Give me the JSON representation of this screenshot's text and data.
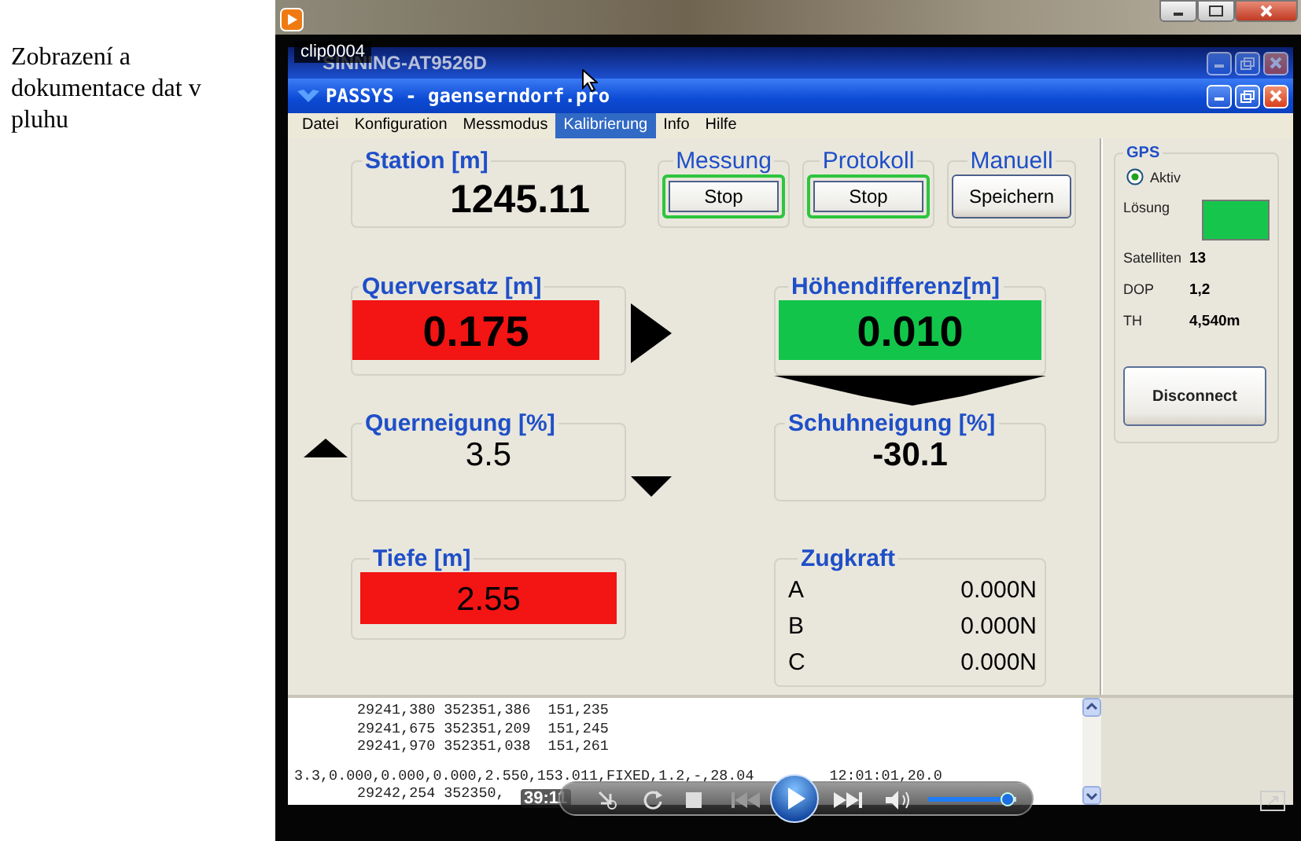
{
  "caption": "Zobrazení a dokumentace dat v pluhu",
  "player": {
    "clip_title": "clip0004",
    "time": "39:11",
    "volume": {
      "level": 0.9
    }
  },
  "outer_window": {
    "title": "SINNING-AT9526D"
  },
  "app_window": {
    "title": "PASSYS - gaenserndorf.pro"
  },
  "menu": [
    {
      "label": "Datei",
      "selected": false
    },
    {
      "label": "Konfiguration",
      "selected": false
    },
    {
      "label": "Messmodus",
      "selected": false
    },
    {
      "label": "Kalibrierung",
      "selected": true
    },
    {
      "label": "Info",
      "selected": false
    },
    {
      "label": "Hilfe",
      "selected": false
    }
  ],
  "station": {
    "label": "Station [m]",
    "value": "1245.11"
  },
  "controls": [
    {
      "label": "Messung",
      "button": "Stop",
      "active": true
    },
    {
      "label": "Protokoll",
      "button": "Stop",
      "active": true
    },
    {
      "label": "Manuell",
      "button": "Speichern",
      "active": false
    }
  ],
  "gauges": [
    {
      "label": "Querversatz [m]",
      "value": "0.175",
      "color": "#f31414"
    },
    {
      "label": "Höhendifferenz[m]",
      "value": "0.010",
      "color": "#12c54a"
    },
    {
      "label": "Querneigung [%]",
      "value": "3.5"
    },
    {
      "label": "Schuhneigung [%]",
      "value": "-30.1"
    },
    {
      "label": "Tiefe [m]",
      "value": "2.55",
      "color": "#f31414"
    }
  ],
  "zugkraft": {
    "label": "Zugkraft",
    "rows": [
      {
        "name": "A",
        "value": "0.000N"
      },
      {
        "name": "B",
        "value": "0.000N"
      },
      {
        "name": "C",
        "value": "0.000N"
      }
    ]
  },
  "gps": {
    "title": "GPS",
    "active": {
      "label": "Aktiv",
      "checked": true
    },
    "solution": {
      "label": "Lösung",
      "color": "#16c64c"
    },
    "fields": [
      {
        "label": "Satelliten",
        "value": "13"
      },
      {
        "label": "DOP",
        "value": "1,2"
      },
      {
        "label": "TH",
        "value": "4,540m"
      }
    ],
    "button": "Disconnect"
  },
  "log": {
    "lines": [
      {
        "kind": "record",
        "parts": [
          "29241,380 352351,386  151,235"
        ]
      },
      {
        "kind": "record",
        "parts": [
          "29241,675 352351,209  151,245"
        ]
      },
      {
        "kind": "record",
        "parts": [
          "29241,970 352351,038  151,261"
        ]
      },
      {
        "kind": "continuation",
        "parts": [
          "3.3,0.000,0.000,0.000,2.550,153.011,FIXED,1.2,-,28.04",
          "12:01:01,20.0"
        ]
      },
      {
        "kind": "record",
        "parts": [
          "29242,254 352350,"
        ]
      }
    ]
  }
}
